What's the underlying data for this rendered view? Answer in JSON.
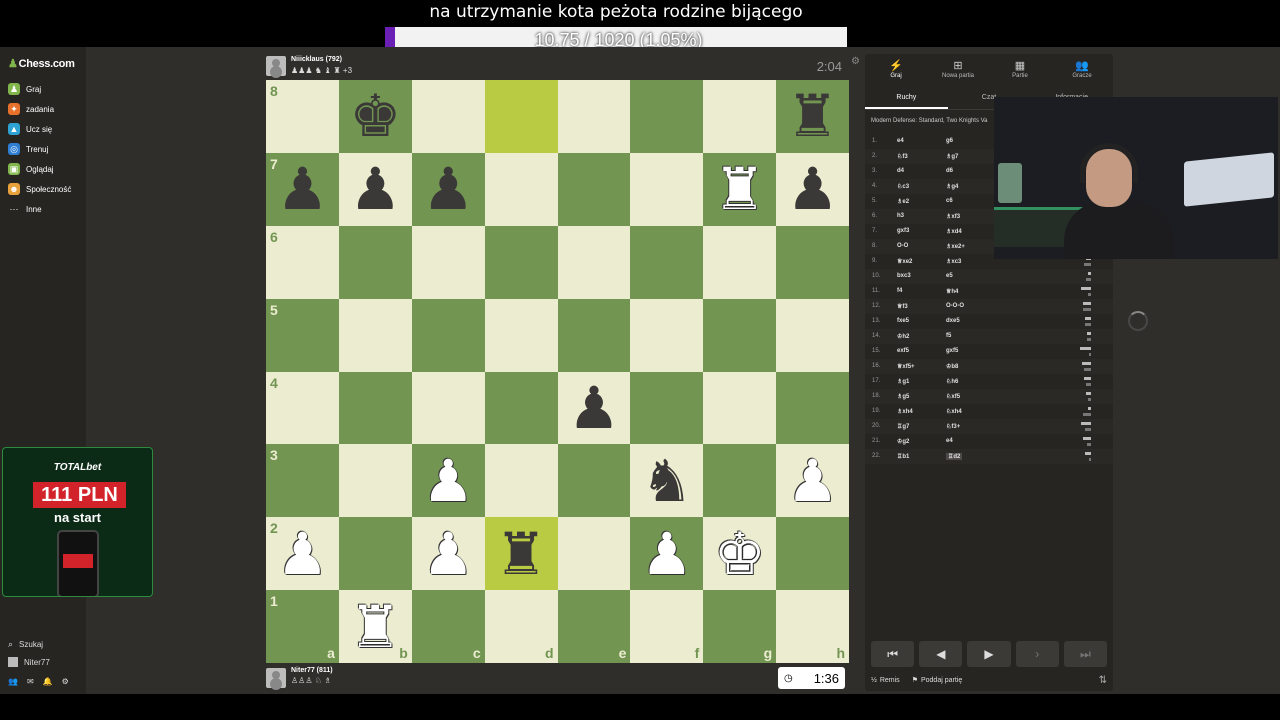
{
  "overlay": {
    "title": "na utrzymanie kota peżota rodzine bijącego",
    "goal_text": "10.75 / 1020 (1.05%)",
    "goal_fraction": 0.0105
  },
  "sidebar": {
    "logo": "Chess.com",
    "items": [
      {
        "label": "Graj",
        "icon": "play-icon",
        "color": "#81b64c"
      },
      {
        "label": "zadania",
        "icon": "puzzle-icon",
        "color": "#e8712b"
      },
      {
        "label": "Ucz się",
        "icon": "learn-icon",
        "color": "#2ea3d3"
      },
      {
        "label": "Trenuj",
        "icon": "train-icon",
        "color": "#2e7fd3"
      },
      {
        "label": "Oglądaj",
        "icon": "watch-icon",
        "color": "#81b64c"
      },
      {
        "label": "Społeczność",
        "icon": "community-icon",
        "color": "#e8a23b"
      },
      {
        "label": "Inne",
        "icon": "more-icon",
        "color": "transparent"
      }
    ],
    "search_label": "Szukaj",
    "user_label": "Niter77",
    "ad": {
      "brand": "TOTALbet",
      "amount": "111 PLN",
      "tagline": "na start"
    }
  },
  "game": {
    "top_player": {
      "name": "Niiicklaus (792)",
      "captured": "♟♟♟ ♞ ♝ ♜ +3",
      "clock": "2:04"
    },
    "bottom_player": {
      "name": "Niter77 (811)",
      "captured": "♙♙♙ ♘ ♗",
      "clock": "1:36",
      "clock_icon": "timer-icon"
    },
    "ranks": [
      "8",
      "7",
      "6",
      "5",
      "4",
      "3",
      "2",
      "1"
    ],
    "files": [
      "a",
      "b",
      "c",
      "d",
      "e",
      "f",
      "g",
      "h"
    ],
    "highlight": [
      "d8",
      "d2"
    ],
    "pieces": {
      "b8": "bK",
      "h8": "bR",
      "a7": "bP",
      "b7": "bP",
      "c7": "bP",
      "g7": "wR",
      "h7": "bP",
      "e4": "bP",
      "c3": "wP",
      "f3": "bN",
      "h3": "wP",
      "a2": "wP",
      "c2": "wP",
      "d2": "bR",
      "f2": "wP",
      "g2": "wK",
      "b1": "wR"
    }
  },
  "panel": {
    "nav": [
      {
        "label": "Graj",
        "icon": "bolt-icon"
      },
      {
        "label": "Nowa partia",
        "icon": "plus-icon"
      },
      {
        "label": "Partie",
        "icon": "board-icon"
      },
      {
        "label": "Gracze",
        "icon": "players-icon"
      }
    ],
    "sub_tabs": [
      "Ruchy",
      "Czat",
      "Informacje"
    ],
    "opening": "Modern Defense: Standard, Two Knights Va",
    "moves": [
      {
        "n": "1.",
        "w": "e4",
        "b": "g6"
      },
      {
        "n": "2.",
        "w": "♘f3",
        "b": "♗g7"
      },
      {
        "n": "3.",
        "w": "d4",
        "b": "d6"
      },
      {
        "n": "4.",
        "w": "♘c3",
        "b": "♗g4"
      },
      {
        "n": "5.",
        "w": "♗e2",
        "b": "c6"
      },
      {
        "n": "6.",
        "w": "h3",
        "b": "♗xf3"
      },
      {
        "n": "7.",
        "w": "gxf3",
        "b": "♗xd4"
      },
      {
        "n": "8.",
        "w": "O-O",
        "b": "♗xe2+"
      },
      {
        "n": "9.",
        "w": "♕xe2",
        "b": "♗xc3"
      },
      {
        "n": "10.",
        "w": "bxc3",
        "b": "e5"
      },
      {
        "n": "11.",
        "w": "f4",
        "b": "♕h4"
      },
      {
        "n": "12.",
        "w": "♕f3",
        "b": "O-O-O"
      },
      {
        "n": "13.",
        "w": "fxe5",
        "b": "dxe5"
      },
      {
        "n": "14.",
        "w": "♔h2",
        "b": "f5"
      },
      {
        "n": "15.",
        "w": "exf5",
        "b": "gxf5"
      },
      {
        "n": "16.",
        "w": "♕xf5+",
        "b": "♔b8"
      },
      {
        "n": "17.",
        "w": "♗g1",
        "b": "♘h6"
      },
      {
        "n": "18.",
        "w": "♗g5",
        "b": "♘xf5"
      },
      {
        "n": "19.",
        "w": "♗xh4",
        "b": "♘xh4"
      },
      {
        "n": "20.",
        "w": "♖g7",
        "b": "♘f3+"
      },
      {
        "n": "21.",
        "w": "♔g2",
        "b": "e4"
      },
      {
        "n": "22.",
        "w": "♖b1",
        "b": "♖d2"
      }
    ],
    "controls": [
      {
        "name": "first-move-button",
        "glyph": "⏮"
      },
      {
        "name": "prev-move-button",
        "glyph": "◀"
      },
      {
        "name": "play-button",
        "glyph": "▶"
      },
      {
        "name": "next-move-button",
        "glyph": "›"
      },
      {
        "name": "last-move-button",
        "glyph": "⏭"
      }
    ],
    "draw_label": "Remis",
    "resign_label": "Poddaj partię",
    "draw_glyph": "½",
    "resign_glyph": "⚑",
    "flip_glyph": "⇅"
  }
}
